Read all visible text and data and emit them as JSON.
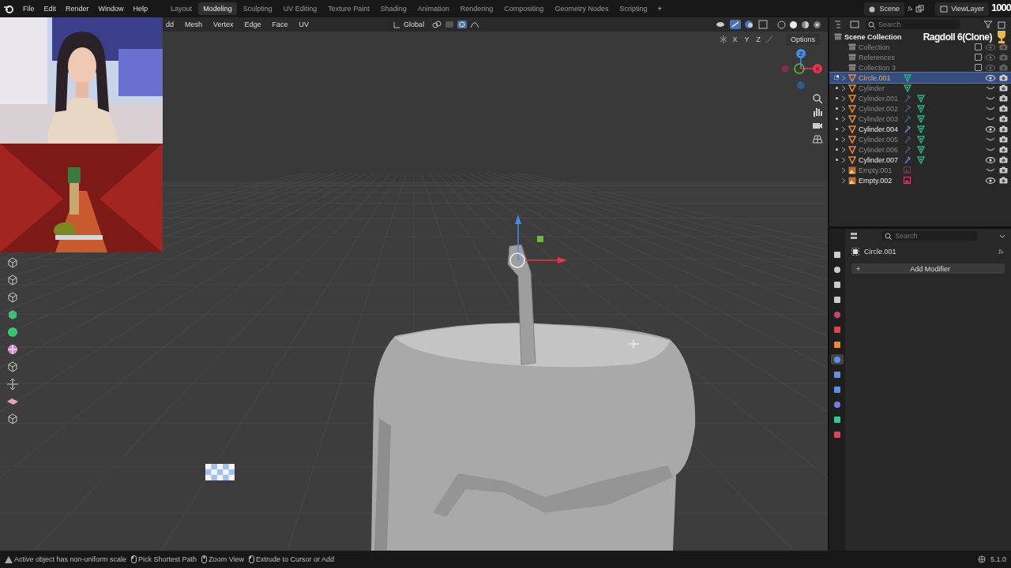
{
  "menu": [
    "File",
    "Edit",
    "Render",
    "Window",
    "Help"
  ],
  "workspaces": [
    {
      "label": "Layout",
      "selected": false
    },
    {
      "label": "Modeling",
      "selected": true
    },
    {
      "label": "Sculpting",
      "selected": false
    },
    {
      "label": "UV Editing",
      "selected": false
    },
    {
      "label": "Texture Paint",
      "selected": false
    },
    {
      "label": "Shading",
      "selected": false
    },
    {
      "label": "Animation",
      "selected": false
    },
    {
      "label": "Rendering",
      "selected": false
    },
    {
      "label": "Compositing",
      "selected": false
    },
    {
      "label": "Geometry Nodes",
      "selected": false
    },
    {
      "label": "Scripting",
      "selected": false
    }
  ],
  "add_workspace": "+",
  "scene": "Scene",
  "view_layer": "ViewLayer",
  "viewport": {
    "menus": [
      "dd",
      "Mesh",
      "Vertex",
      "Edge",
      "Face",
      "UV"
    ],
    "orientation": "Global",
    "axes": [
      "X",
      "Y",
      "Z"
    ],
    "options": "Options",
    "gizmo_axes": [
      "Z",
      "X"
    ]
  },
  "overlay": {
    "counter": "1000",
    "title": "Ragdoll 6(Clone)"
  },
  "outliner": {
    "search_placeholder": "Search",
    "root": {
      "name": "Scene Collection",
      "children": [
        {
          "name": "Collection",
          "kind": "collection",
          "selected": false,
          "checked": false
        },
        {
          "name": "References",
          "kind": "collection",
          "selected": false,
          "checked": false
        },
        {
          "name": "Collection 3",
          "kind": "collection",
          "selected": false,
          "checked": false
        },
        {
          "name": "Circle.001",
          "kind": "mesh",
          "selected": true,
          "hidden": false,
          "modifier": false
        },
        {
          "name": "Cylinder",
          "kind": "mesh",
          "selected": false,
          "hidden": true,
          "modifier": false
        },
        {
          "name": "Cylinder.001",
          "kind": "mesh",
          "selected": false,
          "hidden": true,
          "modifier": true
        },
        {
          "name": "Cylinder.002",
          "kind": "mesh",
          "selected": false,
          "hidden": true,
          "modifier": true
        },
        {
          "name": "Cylinder.003",
          "kind": "mesh",
          "selected": false,
          "hidden": true,
          "modifier": true
        },
        {
          "name": "Cylinder.004",
          "kind": "mesh",
          "selected": false,
          "hidden": false,
          "modifier": true
        },
        {
          "name": "Cylinder.005",
          "kind": "mesh",
          "selected": false,
          "hidden": true,
          "modifier": true
        },
        {
          "name": "Cylinder.006",
          "kind": "mesh",
          "selected": false,
          "hidden": true,
          "modifier": true
        },
        {
          "name": "Cylinder.007",
          "kind": "mesh",
          "selected": false,
          "hidden": false,
          "modifier": true
        },
        {
          "name": "Empty.001",
          "kind": "empty",
          "selected": false,
          "hidden": true,
          "modifier": false
        },
        {
          "name": "Empty.002",
          "kind": "empty",
          "selected": false,
          "hidden": false,
          "modifier": false
        }
      ]
    }
  },
  "properties": {
    "search_placeholder": "Search",
    "object": "Circle.001",
    "add_icon": "+",
    "add_button": "Add Modifier",
    "tabs": [
      {
        "selected": false
      },
      {
        "selected": false
      },
      {
        "selected": false
      },
      {
        "selected": false
      },
      {
        "selected": false
      },
      {
        "selected": false
      },
      {
        "selected": false
      },
      {
        "selected": true
      },
      {
        "selected": false
      },
      {
        "selected": false
      },
      {
        "selected": false
      },
      {
        "selected": false
      },
      {
        "selected": false
      }
    ]
  },
  "status_bar": {
    "hints": [
      "Active object has non-uniform scale",
      "Pick Shortest Path",
      "Zoom View",
      "Extrude to Cursor or Add"
    ],
    "version": "5.1.0"
  }
}
